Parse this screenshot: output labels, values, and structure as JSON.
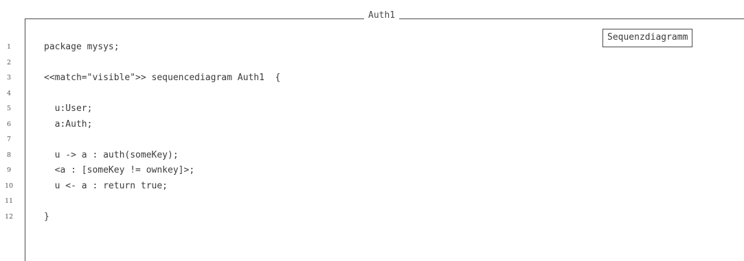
{
  "listing": {
    "title": "Auth1",
    "badge": "Sequenzdiagramm",
    "line_numbers": [
      "1",
      "2",
      "3",
      "4",
      "5",
      "6",
      "7",
      "8",
      "9",
      "10",
      "11",
      "12"
    ],
    "lines": [
      "package mysys;",
      "",
      "<<match=\"visible\">> sequencediagram Auth1  {",
      "",
      "  u:User;",
      "  a:Auth;",
      "",
      "  u -> a : auth(someKey);",
      "  <a : [someKey != ownkey]>;",
      "  u <- a : return true;",
      "",
      "}"
    ]
  }
}
